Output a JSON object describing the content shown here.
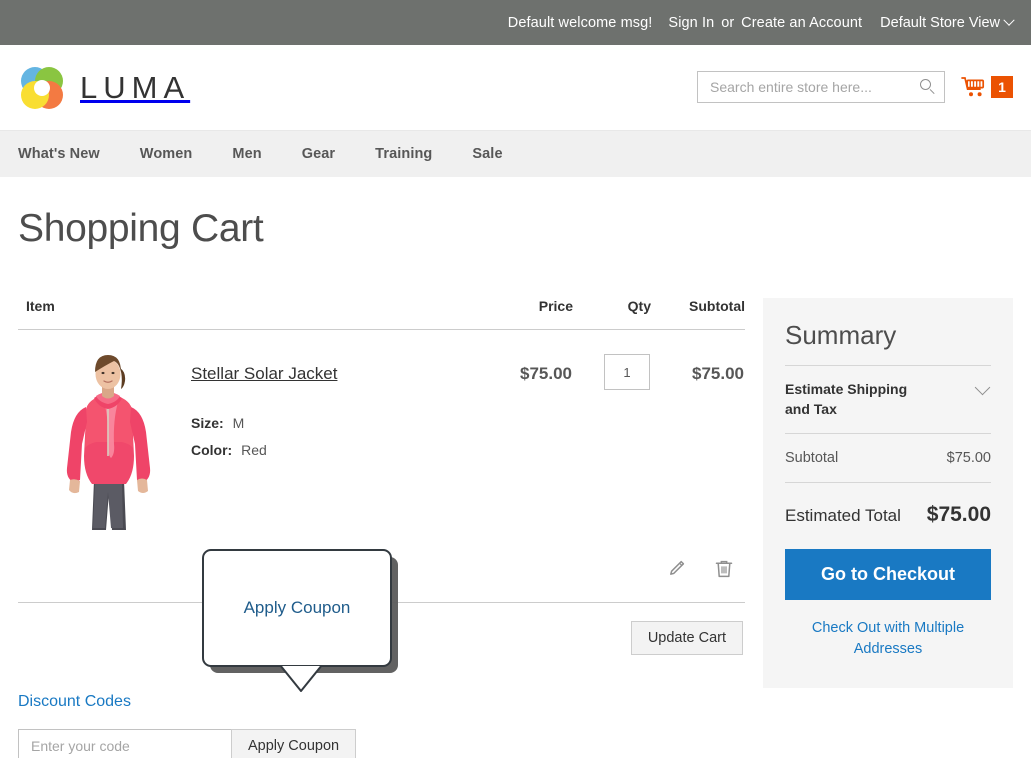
{
  "top_panel": {
    "welcome_message": "Default welcome msg!",
    "sign_in": "Sign In",
    "or": "or",
    "create_account": "Create an Account",
    "store_view": "Default Store View"
  },
  "header": {
    "logo_text": "LUMA",
    "search_placeholder": "Search entire store here...",
    "search_value": "",
    "cart_count": "1",
    "cart_badge_color": "#eb5202"
  },
  "nav": {
    "items": [
      {
        "label": "What's New"
      },
      {
        "label": "Women"
      },
      {
        "label": "Men"
      },
      {
        "label": "Gear"
      },
      {
        "label": "Training"
      },
      {
        "label": "Sale"
      }
    ]
  },
  "main": {
    "page_title": "Shopping Cart"
  },
  "cart": {
    "headers": {
      "item": "Item",
      "price": "Price",
      "qty": "Qty",
      "subtotal": "Subtotal"
    },
    "rows": [
      {
        "name": "Stellar Solar Jacket",
        "price": "$75.00",
        "qty": "1",
        "subtotal": "$75.00",
        "options": [
          {
            "label": "Size:",
            "value": "M"
          },
          {
            "label": "Color:",
            "value": "Red"
          }
        ]
      }
    ],
    "update_cart_label": "Update Cart"
  },
  "discount": {
    "title": "Discount Codes",
    "input_placeholder": "Enter your code",
    "input_value": "",
    "apply_label": "Apply Coupon"
  },
  "summary": {
    "title": "Summary",
    "estimate_label": "Estimate Shipping and Tax",
    "subtotal_label": "Subtotal",
    "subtotal_value": "$75.00",
    "total_label": "Estimated Total",
    "total_value": "$75.00",
    "checkout_label": "Go to Checkout",
    "multi_address_label": "Check Out with Multiple Addresses",
    "accent_color": "#1979c3"
  },
  "callout": {
    "text": "Apply Coupon"
  }
}
